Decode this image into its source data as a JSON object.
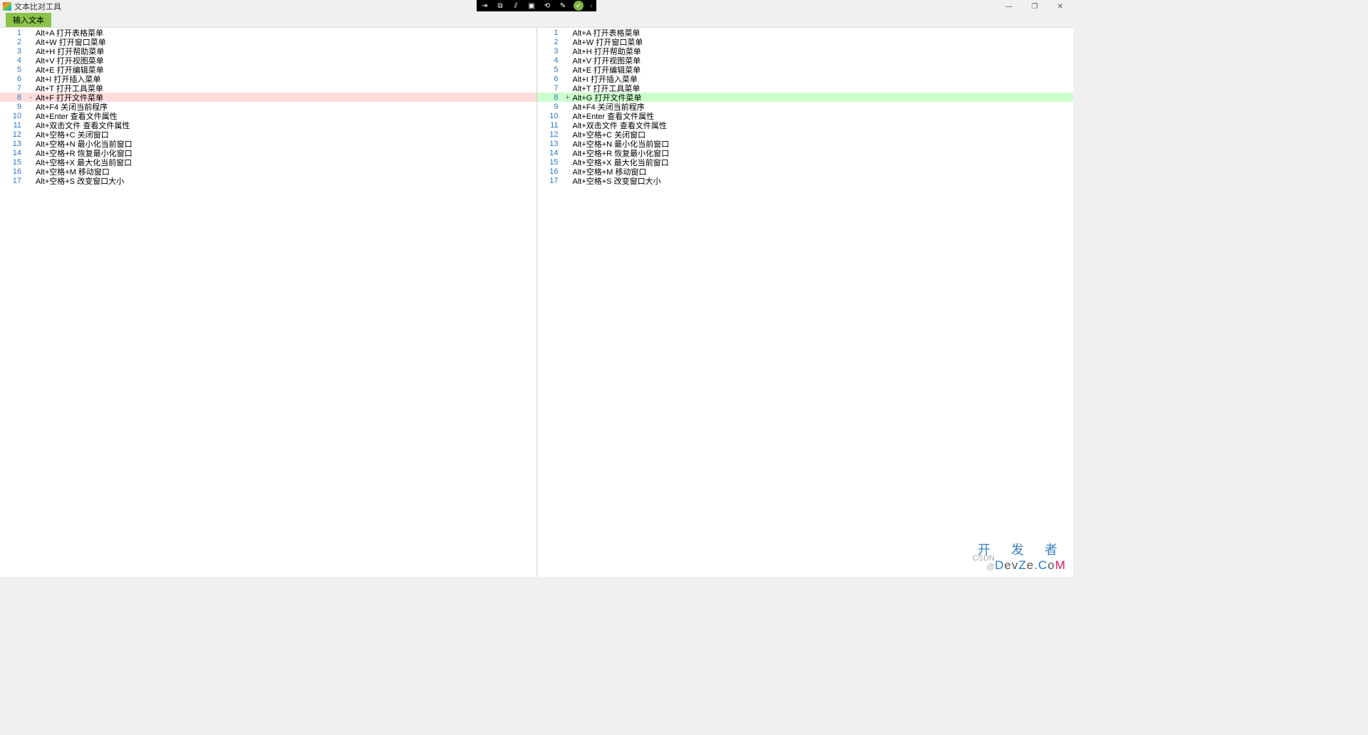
{
  "window": {
    "title": "文本比对工具",
    "controls": {
      "minimize": "—",
      "maximize": "❐",
      "close": "✕"
    }
  },
  "toolbar": {
    "input_button": "输入文本"
  },
  "overlay": {
    "icons": [
      "⇥",
      "⧉",
      "⫽",
      "▣",
      "⟲",
      "✎"
    ],
    "ok": "✓",
    "arrow": "‹"
  },
  "left_lines": [
    {
      "n": 1,
      "t": "Alt+A 打开表格菜单",
      "m": ""
    },
    {
      "n": 2,
      "t": "Alt+W 打开窗口菜单",
      "m": ""
    },
    {
      "n": 3,
      "t": "Alt+H 打开帮助菜单",
      "m": ""
    },
    {
      "n": 4,
      "t": "Alt+V 打开视图菜单",
      "m": ""
    },
    {
      "n": 5,
      "t": "Alt+E 打开编辑菜单",
      "m": ""
    },
    {
      "n": 6,
      "t": "Alt+I 打开插入菜单",
      "m": ""
    },
    {
      "n": 7,
      "t": "Alt+T 打开工具菜单",
      "m": ""
    },
    {
      "n": 8,
      "t": "Alt+F 打开文件菜单",
      "m": "-",
      "cls": "removed"
    },
    {
      "n": 9,
      "t": "Alt+F4 关闭当前程序",
      "m": ""
    },
    {
      "n": 10,
      "t": "Alt+Enter 查看文件属性",
      "m": ""
    },
    {
      "n": 11,
      "t": "Alt+双击文件 查看文件属性",
      "m": ""
    },
    {
      "n": 12,
      "t": "Alt+空格+C 关闭窗口",
      "m": ""
    },
    {
      "n": 13,
      "t": "Alt+空格+N 最小化当前窗口",
      "m": ""
    },
    {
      "n": 14,
      "t": "Alt+空格+R 恢复最小化窗口",
      "m": ""
    },
    {
      "n": 15,
      "t": "Alt+空格+X 最大化当前窗口",
      "m": ""
    },
    {
      "n": 16,
      "t": "Alt+空格+M 移动窗口",
      "m": ""
    },
    {
      "n": 17,
      "t": "Alt+空格+S 改变窗口大小",
      "m": ""
    }
  ],
  "right_lines": [
    {
      "n": 1,
      "t": "Alt+A 打开表格菜单",
      "m": ""
    },
    {
      "n": 2,
      "t": "Alt+W 打开窗口菜单",
      "m": ""
    },
    {
      "n": 3,
      "t": "Alt+H 打开帮助菜单",
      "m": ""
    },
    {
      "n": 4,
      "t": "Alt+V 打开视图菜单",
      "m": ""
    },
    {
      "n": 5,
      "t": "Alt+E 打开编辑菜单",
      "m": ""
    },
    {
      "n": 6,
      "t": "Alt+I 打开插入菜单",
      "m": ""
    },
    {
      "n": 7,
      "t": "Alt+T 打开工具菜单",
      "m": ""
    },
    {
      "n": 8,
      "t": "Alt+G 打开文件菜单",
      "m": "+",
      "cls": "added"
    },
    {
      "n": 9,
      "t": "Alt+F4 关闭当前程序",
      "m": ""
    },
    {
      "n": 10,
      "t": "Alt+Enter 查看文件属性",
      "m": ""
    },
    {
      "n": 11,
      "t": "Alt+双击文件 查看文件属性",
      "m": ""
    },
    {
      "n": 12,
      "t": "Alt+空格+C 关闭窗口",
      "m": ""
    },
    {
      "n": 13,
      "t": "Alt+空格+N 最小化当前窗口",
      "m": ""
    },
    {
      "n": 14,
      "t": "Alt+空格+R 恢复最小化窗口",
      "m": ""
    },
    {
      "n": 15,
      "t": "Alt+空格+X 最大化当前窗口",
      "m": ""
    },
    {
      "n": 16,
      "t": "Alt+空格+M 移动窗口",
      "m": ""
    },
    {
      "n": 17,
      "t": "Alt+空格+S 改变窗口大小",
      "m": ""
    }
  ],
  "watermark": {
    "top": "开 发 者",
    "csdn": "CSDN @",
    "d": "D",
    "rest1": "ev",
    "z": "Z",
    "rest2": "e.",
    "c": "C",
    "rest3": "o",
    "m": "M"
  }
}
